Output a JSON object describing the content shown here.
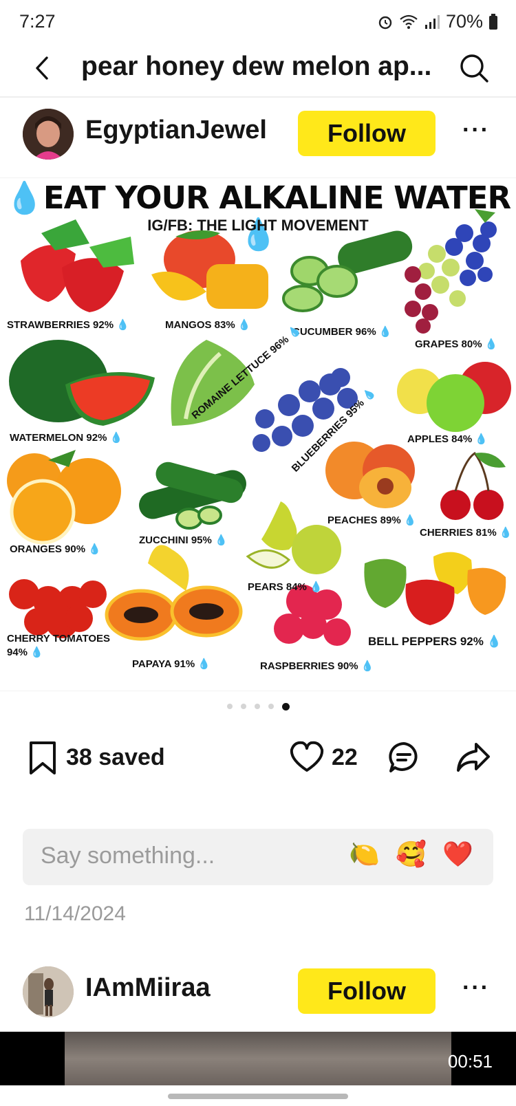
{
  "status_bar": {
    "time": "7:27",
    "battery": "70%"
  },
  "header": {
    "title": "pear honey dew melon ap..."
  },
  "post": {
    "author": "EgyptianJewel",
    "follow_label": "Follow",
    "more_label": "···",
    "image": {
      "title": "EAT YOUR ALKALINE WATER",
      "subtitle": "IG/FB: THE LIGHT MOVEMENT",
      "items": [
        {
          "label": "STRAWBERRIES 92%"
        },
        {
          "label": "MANGOS 83%"
        },
        {
          "label": "CUCUMBER 96%"
        },
        {
          "label": "GRAPES 80%"
        },
        {
          "label": "WATERMELON 92%"
        },
        {
          "label": "ROMAINE LETTUCE 96%"
        },
        {
          "label": "BLUEBERRIES 95%"
        },
        {
          "label": "APPLES 84%"
        },
        {
          "label": "ORANGES 90%"
        },
        {
          "label": "ZUCCHINI 95%"
        },
        {
          "label": "PEACHES 89%"
        },
        {
          "label": "CHERRIES 81%"
        },
        {
          "label": "PEARS 84%"
        },
        {
          "label": "CHERRY TOMATOES 94%"
        },
        {
          "label": "PAPAYA 91%"
        },
        {
          "label": "RASPBERRIES 90%"
        },
        {
          "label": "BELL PEPPERS 92%"
        }
      ]
    },
    "carousel": {
      "count": 5,
      "active_index": 4
    },
    "saved_label": "38 saved",
    "likes": "22",
    "comment_placeholder": "Say something...",
    "emojis": [
      "🍋",
      "🥰",
      "❤️"
    ],
    "date": "11/14/2024"
  },
  "next_post": {
    "author": "IAmMiiraa",
    "follow_label": "Follow",
    "more_label": "···",
    "video_duration": "00:51"
  },
  "colors": {
    "follow_bg": "#ffe81a",
    "drop": "#2aa0e0"
  },
  "icons": [
    "back-icon",
    "search-icon",
    "bookmark-icon",
    "heart-icon",
    "comment-icon",
    "share-icon"
  ]
}
